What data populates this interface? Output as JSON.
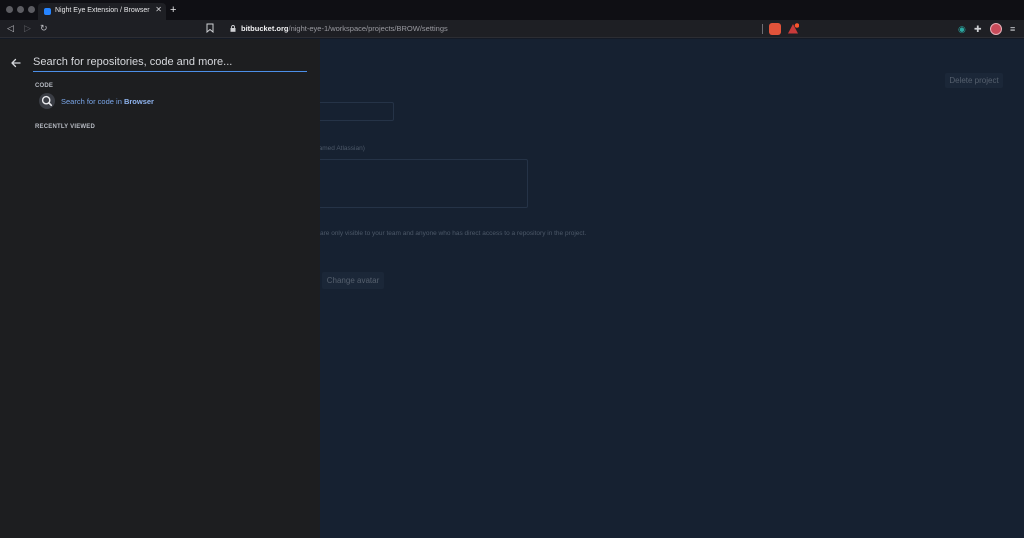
{
  "browser": {
    "tab_title": "Night Eye Extension / Browser /",
    "tab_close": "✕",
    "new_tab": "+",
    "url_host": "bitbucket.org",
    "url_path": "/night-eye-1/workspace/projects/BROW/settings"
  },
  "page": {
    "delete_label": "Delete project",
    "name_hint": "named Atlassian)",
    "private_text": "are only visible to your team and anyone who has direct access to a repository in the project.",
    "change_avatar_label": "Change avatar"
  },
  "search": {
    "placeholder": "Search for repositories, code and more...",
    "code_heading": "CODE",
    "code_result_prefix": "Search for code in",
    "code_result_target": "Browser",
    "recent_heading": "RECENTLY VIEWED"
  },
  "colors": {
    "accent": "#4c8fe8",
    "drawer_bg": "#1d1e20",
    "page_bg": "#162131"
  }
}
